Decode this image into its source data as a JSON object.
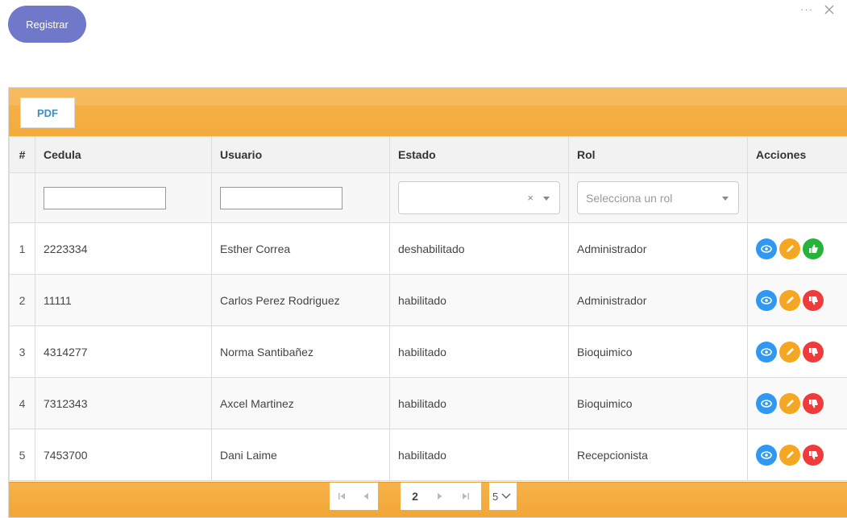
{
  "toolbar": {
    "register_label": "Registrar",
    "pdf_label": "PDF"
  },
  "window": {
    "more_label": "···"
  },
  "columns": [
    "#",
    "Cedula",
    "Usuario",
    "Estado",
    "Rol",
    "Acciones"
  ],
  "filters": {
    "rol_placeholder": "Selecciona un rol",
    "estado_clear": "×"
  },
  "rows": [
    {
      "num": "1",
      "cedula": "2223334",
      "usuario": "Esther Correa",
      "estado": "deshabilitado",
      "rol": "Administrador",
      "toggle": "habilitar"
    },
    {
      "num": "2",
      "cedula": "11111",
      "usuario": "Carlos Perez Rodriguez",
      "estado": "habilitado",
      "rol": "Administrador",
      "toggle": "deshabilitar"
    },
    {
      "num": "3",
      "cedula": "4314277",
      "usuario": "Norma Santibañez",
      "estado": "habilitado",
      "rol": "Bioquimico",
      "toggle": "deshabilitar"
    },
    {
      "num": "4",
      "cedula": "7312343",
      "usuario": "Axcel Martinez",
      "estado": "habilitado",
      "rol": "Bioquimico",
      "toggle": "deshabilitar"
    },
    {
      "num": "5",
      "cedula": "7453700",
      "usuario": "Dani Laime",
      "estado": "habilitado",
      "rol": "Recepcionista",
      "toggle": "deshabilitar"
    }
  ],
  "pager": {
    "current_page": "2",
    "page_size": "5"
  },
  "colors": {
    "toolbar": "#f4ab3d",
    "register_button": "#6f78c9",
    "view": "#2f98f0",
    "edit": "#f5a623",
    "enable": "#26b33a",
    "disable": "#ef3b3b"
  }
}
